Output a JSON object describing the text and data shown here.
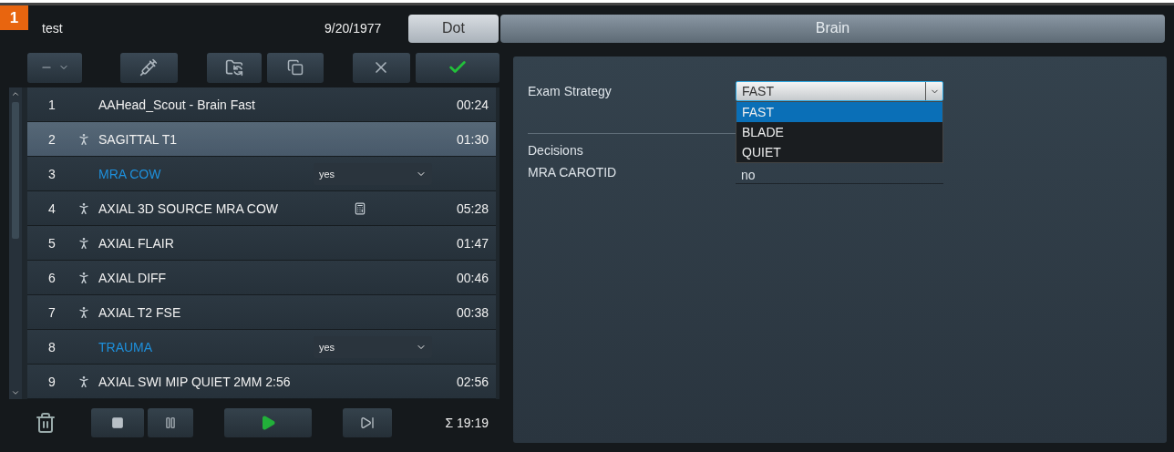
{
  "badge": "1",
  "header": {
    "patient": "test",
    "birth_date": "9/20/1977",
    "tabs": [
      {
        "label": "Dot",
        "selected": true
      },
      {
        "label": "Brain",
        "selected": false
      }
    ]
  },
  "protocol_list": {
    "rows": [
      {
        "number": "1",
        "kind": "scout",
        "name": "AAHead_Scout - Brain Fast",
        "time": "00:24",
        "selected": false
      },
      {
        "number": "2",
        "kind": "step",
        "name": "SAGITTAL T1",
        "time": "01:30",
        "selected": true
      },
      {
        "number": "3",
        "kind": "decision",
        "name": "MRA COW",
        "value": "yes",
        "selected": false
      },
      {
        "number": "4",
        "kind": "step",
        "name": "AXIAL 3D SOURCE MRA COW",
        "time": "05:28",
        "selected": false,
        "calc_icon": true
      },
      {
        "number": "5",
        "kind": "step",
        "name": "AXIAL FLAIR",
        "time": "01:47",
        "selected": false
      },
      {
        "number": "6",
        "kind": "step",
        "name": "AXIAL DIFF",
        "time": "00:46",
        "selected": false
      },
      {
        "number": "7",
        "kind": "step",
        "name": "AXIAL T2 FSE",
        "time": "00:38",
        "selected": false
      },
      {
        "number": "8",
        "kind": "decision",
        "name": "TRAUMA",
        "value": "yes",
        "selected": false
      },
      {
        "number": "9",
        "kind": "step",
        "name": "AXIAL SWI MIP QUIET 2MM 2:56",
        "time": "02:56",
        "selected": false
      }
    ]
  },
  "total_time": "Σ 19:19",
  "strategy_panel": {
    "exam_strategy": {
      "label": "Exam Strategy",
      "value": "FAST",
      "expanded": true,
      "options": [
        {
          "label": "FAST",
          "selected": true
        },
        {
          "label": "BLADE",
          "selected": false
        },
        {
          "label": "QUIET",
          "selected": false
        }
      ]
    },
    "decisions_heading": "Decisions",
    "decisions": [
      {
        "label": "MRA CAROTID",
        "value": "no"
      }
    ]
  }
}
